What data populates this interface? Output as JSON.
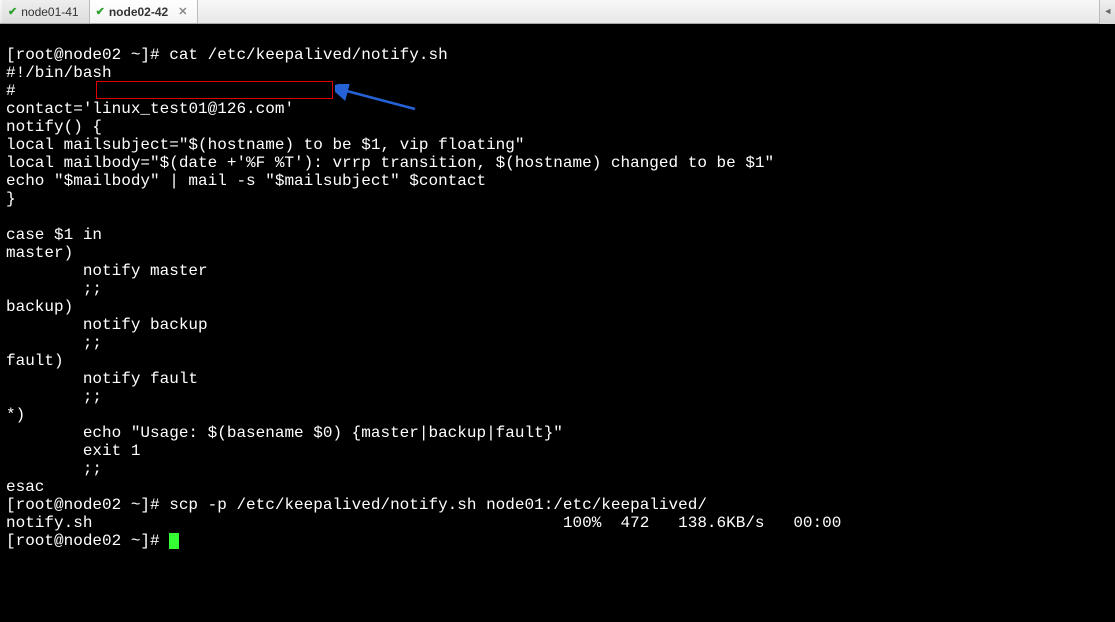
{
  "tabs": {
    "tab1": {
      "label": "node01-41"
    },
    "tab2": {
      "label": "node02-42"
    }
  },
  "terminal": {
    "line1": "[root@node02 ~]# cat /etc/keepalived/notify.sh",
    "line2": "#!/bin/bash",
    "line3": "#",
    "line4a": "contact='",
    "line4b": "linux_test01@126.com",
    "line4c": "'",
    "line5": "notify() {",
    "line6": "local mailsubject=\"$(hostname) to be $1, vip floating\"",
    "line7": "local mailbody=\"$(date +'%F %T'): vrrp transition, $(hostname) changed to be $1\"",
    "line8": "echo \"$mailbody\" | mail -s \"$mailsubject\" $contact",
    "line9": "}",
    "line10": "",
    "line11": "case $1 in",
    "line12": "master)",
    "line13": "        notify master",
    "line14": "        ;;",
    "line15": "backup)",
    "line16": "        notify backup",
    "line17": "        ;;",
    "line18": "fault)",
    "line19": "        notify fault",
    "line20": "        ;;",
    "line21": "*)",
    "line22": "        echo \"Usage: $(basename $0) {master|backup|fault}\"",
    "line23": "        exit 1",
    "line24": "        ;;",
    "line25": "esac",
    "line26": "[root@node02 ~]# scp -p /etc/keepalived/notify.sh node01:/etc/keepalived/",
    "line27": "notify.sh                                                 100%  472   138.6KB/s   00:00",
    "line28": "[root@node02 ~]# "
  },
  "highlight": {
    "contact_email": "linux_test01@126.com"
  }
}
